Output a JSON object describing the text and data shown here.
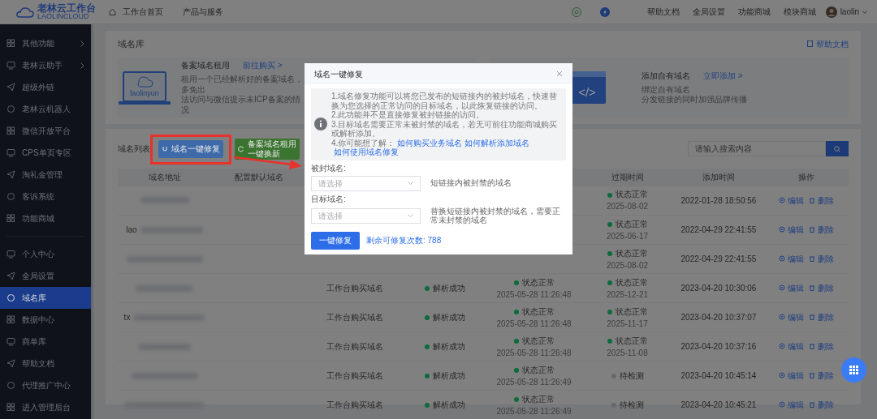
{
  "topbar": {
    "logo_text": "老林云工作台",
    "logo_subtext": "LAOLINCLOUD",
    "nav": [
      {
        "label": "工作台首页",
        "icon": true
      },
      {
        "label": "产品与服务",
        "icon": false
      }
    ],
    "links": [
      "帮助文档",
      "全局设置",
      "功能商城",
      "模块商城"
    ],
    "user": "laolin"
  },
  "sidebar": {
    "groups": [
      [
        {
          "label": "其他功能",
          "submenu": true,
          "selected": false
        },
        {
          "label": "老林云助手",
          "submenu": true,
          "selected": false
        },
        {
          "label": "超级外链",
          "submenu": false,
          "selected": false
        },
        {
          "label": "老林云机器人",
          "submenu": false,
          "selected": false
        },
        {
          "label": "微信开放平台",
          "submenu": false,
          "selected": false
        },
        {
          "label": "CPS单页专区",
          "submenu": false,
          "selected": false
        },
        {
          "label": "淘礼金管理",
          "submenu": false,
          "selected": false
        },
        {
          "label": "客诉系统",
          "submenu": false,
          "selected": false
        },
        {
          "label": "功能商城",
          "submenu": false,
          "selected": false
        }
      ],
      [
        {
          "label": "个人中心",
          "submenu": false,
          "selected": false
        },
        {
          "label": "全局设置",
          "submenu": false,
          "selected": false
        },
        {
          "label": "域名库",
          "submenu": false,
          "selected": true
        },
        {
          "label": "数据中心",
          "submenu": false,
          "selected": false
        },
        {
          "label": "商单库",
          "submenu": false,
          "selected": false
        },
        {
          "label": "帮助文档",
          "submenu": false,
          "selected": false
        },
        {
          "label": "代理推广中心",
          "submenu": false,
          "selected": false
        },
        {
          "label": "进入管理后台",
          "submenu": false,
          "selected": false
        }
      ]
    ]
  },
  "page": {
    "title": "域名库",
    "help_link": "帮助文档",
    "promos": [
      {
        "kind": "laptop",
        "art_text": "laolinyun",
        "title": "备案域名租用",
        "link": "前往购买 >",
        "lines": [
          "租用一个已经解析好的备案域名，多免出",
          "法访问与微信提示未ICP备案的情况"
        ]
      },
      {
        "kind": "code",
        "art_text": "</>",
        "title": "添加自有域名",
        "link": "立即添加 >",
        "lines": [
          "绑定自有域名",
          "分发链接的同时加强品牌传播"
        ]
      }
    ]
  },
  "list": {
    "title": "域名列表",
    "buttons": [
      {
        "label": "域名一键修复",
        "kind": "primary"
      },
      {
        "label": "备案域名租用一键换新",
        "kind": "success"
      }
    ],
    "search": {
      "placeholder": "请输入搜索内容"
    },
    "columns": [
      "域名地址",
      "配置默认域名",
      null,
      null,
      null,
      "过期时间",
      "添加时间",
      "操作"
    ],
    "rows": [
      {
        "expiry": {
          "label": "状态正常",
          "color": "#0b6b3c",
          "date": "2025-08-02"
        },
        "added": "2022-01-28 18:50:56",
        "actions": [
          "编辑",
          "删除"
        ]
      },
      {
        "domain_prefix": "lao",
        "expiry": {
          "label": "状态正常",
          "color": "#0b6b3c",
          "date": "2025-06-17"
        },
        "added": "2022-04-29 22:41:55",
        "actions": [
          "编辑",
          "删除"
        ]
      },
      {
        "expiry": {
          "label": "状态正常",
          "color": "#0b6b3c",
          "date": "2025-08-02"
        },
        "added": "2022-04-29 22:41:55",
        "actions": [
          "编辑",
          "删除"
        ]
      },
      {
        "source": "工作台购买域名",
        "resolve": {
          "label": "解析成功",
          "color": "#0b6b3c"
        },
        "status": {
          "label": "状态正常",
          "color": "#0b6b3c",
          "time": "2025-05-28 11:26:48"
        },
        "expiry": {
          "label": "状态正常",
          "color": "#0b6b3c",
          "date": "2025-12-21"
        },
        "added": "2023-04-20 10:30:06",
        "actions": [
          "编辑",
          "删除"
        ]
      },
      {
        "domain_prefix": "tx",
        "source": "工作台购买域名",
        "resolve": {
          "label": "解析成功",
          "color": "#0b6b3c"
        },
        "status": {
          "label": "状态正常",
          "color": "#0b6b3c",
          "time": "2025-05-28 11:26:48"
        },
        "expiry": {
          "label": "状态正常",
          "color": "#0b6b3c",
          "date": "2025-11-17"
        },
        "added": "2023-04-20 10:37:07",
        "actions": [
          "编辑",
          "删除"
        ]
      },
      {
        "source": "工作台购买域名",
        "resolve": {
          "label": "解析成功",
          "color": "#0b6b3c"
        },
        "status": {
          "label": "状态正常",
          "color": "#0b6b3c",
          "time": "2025-05-28 11:26:48"
        },
        "expiry": {
          "label": "状态正常",
          "color": "#0b6b3c",
          "date": "2025-11-08"
        },
        "added": "2023-04-20 10:37:16",
        "actions": [
          "编辑",
          "删除"
        ]
      },
      {
        "source": "工作台购买域名",
        "resolve": {
          "label": "解析成功",
          "color": "#0b6b3c"
        },
        "status": {
          "label": "状态正常",
          "color": "#0b6b3c",
          "time": "2025-05-28 11:26:49"
        },
        "expiry": {
          "label": "待检测",
          "color": "#66686c"
        },
        "added": "2023-04-20 10:45:14",
        "actions": [
          "编辑",
          "删除"
        ]
      },
      {
        "source": "工作台购买域名",
        "resolve": {
          "label": "解析成功",
          "color": "#0b6b3c"
        },
        "status": {
          "label": "状态正常",
          "color": "#0b6b3c",
          "time": "2025-05-28 11:26:49"
        },
        "expiry": {
          "label": "待检测",
          "color": "#66686c"
        },
        "added": "2023-04-20 10:45:21",
        "actions": [
          "编辑",
          "删除"
        ]
      }
    ]
  },
  "modal": {
    "title": "域名一键修复",
    "notes": [
      "1.域名修复功能可以将您已发布的短链接内的被封域名，快速替换为您选择的正常访问的目标域名，以此恢复链接的访问。",
      "2.此功能并不是直接修复被封链接的访问。",
      "3.目标域名需要正常未被封禁的域名，若无可前往功能商城购买或解析添加。"
    ],
    "links_intro": "4.你可能想了解：",
    "links": [
      "如何购买业务域名",
      "如何解析添加域名",
      "如何使用域名修复"
    ],
    "fields": [
      {
        "label": "被封域名:",
        "placeholder": "请选择",
        "hint": "短链接内被封禁的域名"
      },
      {
        "label": "目标域名:",
        "placeholder": "请选择",
        "hint": "替换短链接内被封禁的域名，需要正常未封禁的域名"
      }
    ],
    "submit": "一键修复",
    "remaining": "剩余可修复次数: 788"
  }
}
